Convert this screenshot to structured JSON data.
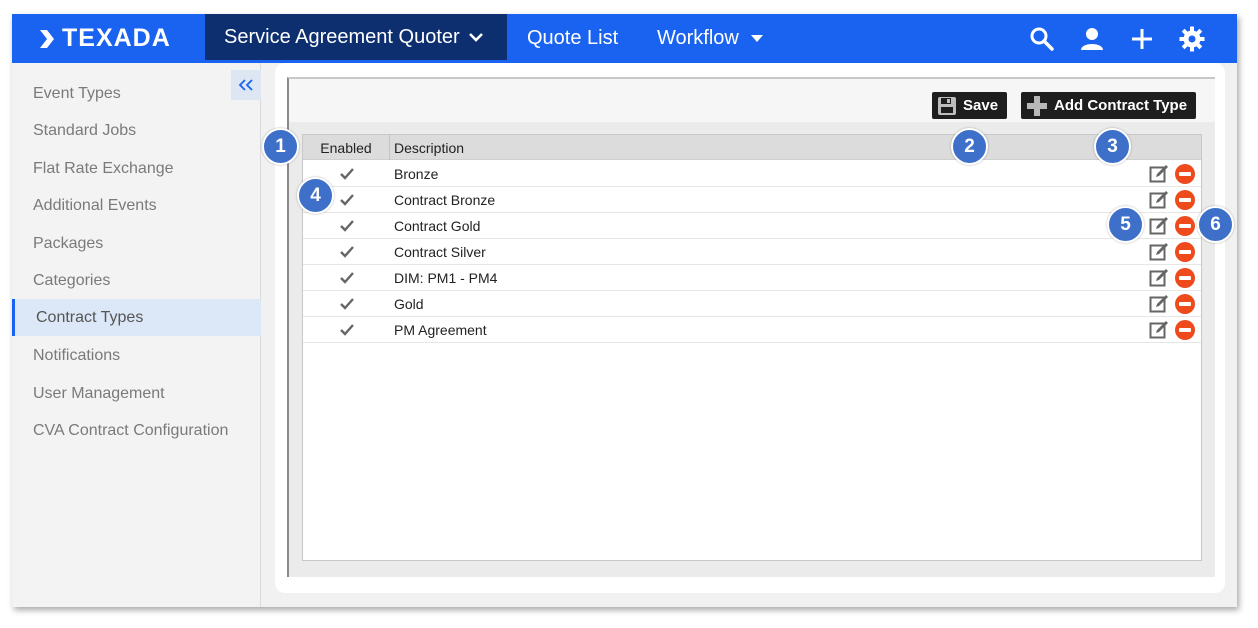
{
  "app": {
    "logo_text": "TEXADA",
    "nav": {
      "active_label": "Service Agreement Quoter",
      "quote_list": "Quote List",
      "workflow": "Workflow"
    },
    "icons": [
      "search-icon",
      "user-icon",
      "plus-icon",
      "gear-icon"
    ],
    "colors": {
      "topbar": "#1a63f0",
      "active_nav": "#0d2f70",
      "delete": "#ee4a1c",
      "badge": "#3e6fc9"
    }
  },
  "sidebar": {
    "collapse_icon": "«",
    "items": [
      {
        "label": "Event Types"
      },
      {
        "label": "Standard Jobs"
      },
      {
        "label": "Flat Rate Exchange"
      },
      {
        "label": "Additional Events"
      },
      {
        "label": "Packages"
      },
      {
        "label": "Categories"
      },
      {
        "label": "Contract Types",
        "active": true
      },
      {
        "label": "Notifications"
      },
      {
        "label": "User Management"
      },
      {
        "label": "CVA Contract Configuration"
      }
    ]
  },
  "toolbar": {
    "save_label": "Save",
    "add_label": "Add Contract Type"
  },
  "grid": {
    "columns": {
      "enabled": "Enabled",
      "description": "Description"
    },
    "rows": [
      {
        "enabled": true,
        "description": "Bronze"
      },
      {
        "enabled": true,
        "description": "Contract Bronze"
      },
      {
        "enabled": true,
        "description": "Contract Gold"
      },
      {
        "enabled": true,
        "description": "Contract Silver"
      },
      {
        "enabled": true,
        "description": "DIM: PM1 - PM4"
      },
      {
        "enabled": true,
        "description": "Gold"
      },
      {
        "enabled": true,
        "description": "PM Agreement"
      }
    ]
  },
  "callouts": [
    "1",
    "2",
    "3",
    "4",
    "5",
    "6"
  ]
}
